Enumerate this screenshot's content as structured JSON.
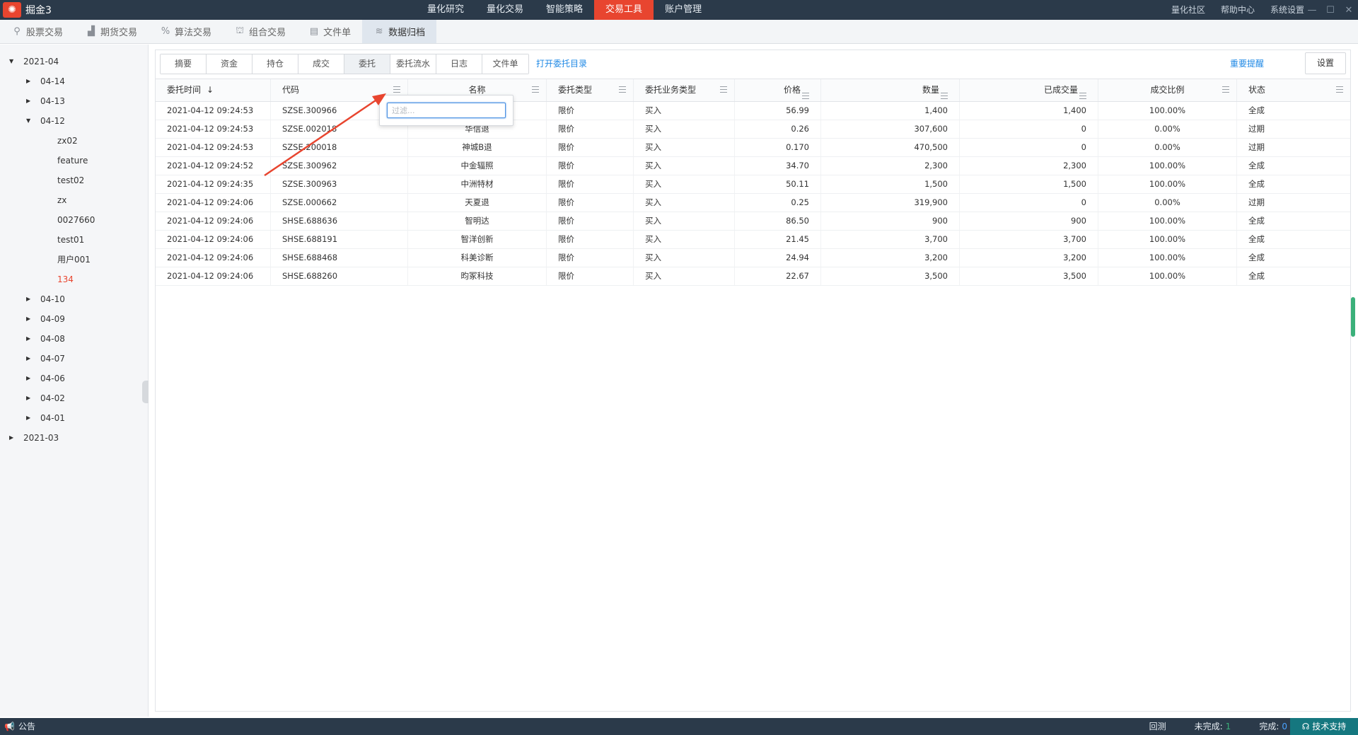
{
  "app": {
    "title": "掘金3"
  },
  "main_nav": [
    {
      "label": "量化研究",
      "active": false
    },
    {
      "label": "量化交易",
      "active": false
    },
    {
      "label": "智能策略",
      "active": false
    },
    {
      "label": "交易工具",
      "active": true
    },
    {
      "label": "账户管理",
      "active": false
    }
  ],
  "right_nav": [
    "量化社区",
    "帮助中心",
    "系统设置"
  ],
  "sub_tabs": [
    {
      "label": "股票交易",
      "icon": "stock-trade-icon",
      "glyph": "⚲"
    },
    {
      "label": "期货交易",
      "icon": "futures-chart-icon",
      "glyph": "▟"
    },
    {
      "label": "算法交易",
      "icon": "percent-icon",
      "glyph": "%"
    },
    {
      "label": "组合交易",
      "icon": "basket-icon",
      "glyph": "⛫"
    },
    {
      "label": "文件单",
      "icon": "document-icon",
      "glyph": "▤"
    },
    {
      "label": "数据归档",
      "icon": "layers-icon",
      "glyph": "≋",
      "active": true
    }
  ],
  "tree": [
    {
      "label": "2021-04",
      "level": 0,
      "expanded": true
    },
    {
      "label": "04-14",
      "level": 1,
      "expanded": false
    },
    {
      "label": "04-13",
      "level": 1,
      "expanded": false
    },
    {
      "label": "04-12",
      "level": 1,
      "expanded": true
    },
    {
      "label": "zx02",
      "level": 2
    },
    {
      "label": "feature",
      "level": 2
    },
    {
      "label": "test02",
      "level": 2
    },
    {
      "label": "zx",
      "level": 2
    },
    {
      "label": "0027660",
      "level": 2
    },
    {
      "label": "test01",
      "level": 2
    },
    {
      "label": "用户001",
      "level": 2
    },
    {
      "label": "134",
      "level": 2,
      "selected": true
    },
    {
      "label": "04-10",
      "level": 1,
      "expanded": false
    },
    {
      "label": "04-09",
      "level": 1,
      "expanded": false
    },
    {
      "label": "04-08",
      "level": 1,
      "expanded": false
    },
    {
      "label": "04-07",
      "level": 1,
      "expanded": false
    },
    {
      "label": "04-06",
      "level": 1,
      "expanded": false
    },
    {
      "label": "04-02",
      "level": 1,
      "expanded": false
    },
    {
      "label": "04-01",
      "level": 1,
      "expanded": false
    },
    {
      "label": "2021-03",
      "level": 0,
      "expanded": false
    }
  ],
  "content_tabs": [
    {
      "label": "摘要"
    },
    {
      "label": "资金"
    },
    {
      "label": "持仓"
    },
    {
      "label": "成交"
    },
    {
      "label": "委托",
      "active": true
    },
    {
      "label": "委托流水"
    },
    {
      "label": "日志"
    },
    {
      "label": "文件单"
    }
  ],
  "open_dir_link": "打开委托目录",
  "important_link": "重要提醒",
  "settings_button": "设置",
  "table": {
    "columns": [
      {
        "key": "time",
        "label": "委托时间",
        "sort": "desc",
        "menu": "none",
        "align": "l",
        "cell_align": "l"
      },
      {
        "key": "code",
        "label": "代码",
        "menu": "right",
        "align": "l",
        "cell_align": "l"
      },
      {
        "key": "name",
        "label": "名称",
        "menu": "right",
        "align": "c",
        "cell_align": "c"
      },
      {
        "key": "order_type",
        "label": "委托类型",
        "menu": "right",
        "align": "l",
        "cell_align": "l"
      },
      {
        "key": "biz_type",
        "label": "委托业务类型",
        "menu": "right",
        "align": "l",
        "cell_align": "l"
      },
      {
        "key": "price",
        "label": "价格",
        "menu": "inline",
        "align": "r",
        "cell_align": "r"
      },
      {
        "key": "qty",
        "label": "数量",
        "menu": "inline",
        "align": "r",
        "cell_align": "r"
      },
      {
        "key": "filled",
        "label": "已成交量",
        "menu": "inline",
        "align": "r",
        "cell_align": "r"
      },
      {
        "key": "ratio",
        "label": "成交比例",
        "menu": "right",
        "align": "c",
        "cell_align": "c"
      },
      {
        "key": "status",
        "label": "状态",
        "menu": "right",
        "align": "l",
        "cell_align": "l"
      }
    ],
    "rows": [
      {
        "time": "2021-04-12 09:24:53",
        "code": "SZSE.300966",
        "name": "",
        "order_type": "限价",
        "biz_type": "买入",
        "price": "56.99",
        "qty": "1,400",
        "filled": "1,400",
        "ratio": "100.00%",
        "status": "全成"
      },
      {
        "time": "2021-04-12 09:24:53",
        "code": "SZSE.002018",
        "name": "华信退",
        "order_type": "限价",
        "biz_type": "买入",
        "price": "0.26",
        "qty": "307,600",
        "filled": "0",
        "ratio": "0.00%",
        "status": "过期"
      },
      {
        "time": "2021-04-12 09:24:53",
        "code": "SZSE.200018",
        "name": "神城B退",
        "order_type": "限价",
        "biz_type": "买入",
        "price": "0.170",
        "qty": "470,500",
        "filled": "0",
        "ratio": "0.00%",
        "status": "过期"
      },
      {
        "time": "2021-04-12 09:24:52",
        "code": "SZSE.300962",
        "name": "中金辐照",
        "order_type": "限价",
        "biz_type": "买入",
        "price": "34.70",
        "qty": "2,300",
        "filled": "2,300",
        "ratio": "100.00%",
        "status": "全成"
      },
      {
        "time": "2021-04-12 09:24:35",
        "code": "SZSE.300963",
        "name": "中洲特材",
        "order_type": "限价",
        "biz_type": "买入",
        "price": "50.11",
        "qty": "1,500",
        "filled": "1,500",
        "ratio": "100.00%",
        "status": "全成"
      },
      {
        "time": "2021-04-12 09:24:06",
        "code": "SZSE.000662",
        "name": "天夏退",
        "order_type": "限价",
        "biz_type": "买入",
        "price": "0.25",
        "qty": "319,900",
        "filled": "0",
        "ratio": "0.00%",
        "status": "过期"
      },
      {
        "time": "2021-04-12 09:24:06",
        "code": "SHSE.688636",
        "name": "智明达",
        "order_type": "限价",
        "biz_type": "买入",
        "price": "86.50",
        "qty": "900",
        "filled": "900",
        "ratio": "100.00%",
        "status": "全成"
      },
      {
        "time": "2021-04-12 09:24:06",
        "code": "SHSE.688191",
        "name": "智洋创新",
        "order_type": "限价",
        "biz_type": "买入",
        "price": "21.45",
        "qty": "3,700",
        "filled": "3,700",
        "ratio": "100.00%",
        "status": "全成"
      },
      {
        "time": "2021-04-12 09:24:06",
        "code": "SHSE.688468",
        "name": "科美诊断",
        "order_type": "限价",
        "biz_type": "买入",
        "price": "24.94",
        "qty": "3,200",
        "filled": "3,200",
        "ratio": "100.00%",
        "status": "全成"
      },
      {
        "time": "2021-04-12 09:24:06",
        "code": "SHSE.688260",
        "name": "昀冢科技",
        "order_type": "限价",
        "biz_type": "买入",
        "price": "22.67",
        "qty": "3,500",
        "filled": "3,500",
        "ratio": "100.00%",
        "status": "全成"
      }
    ]
  },
  "filter_popup": {
    "placeholder": "过滤..."
  },
  "annotation": {
    "color": "#e8452f"
  },
  "status_bar": {
    "notice": "公告",
    "backtest": "回测",
    "incomplete_label": "未完成:",
    "incomplete_count": "1",
    "complete_label": "完成:",
    "complete_count": "0",
    "support": "技术支持"
  },
  "colors": {
    "accent": "#e8452f",
    "topbar": "#2b3a4a",
    "link": "#1e88e5",
    "support": "#15777f"
  }
}
